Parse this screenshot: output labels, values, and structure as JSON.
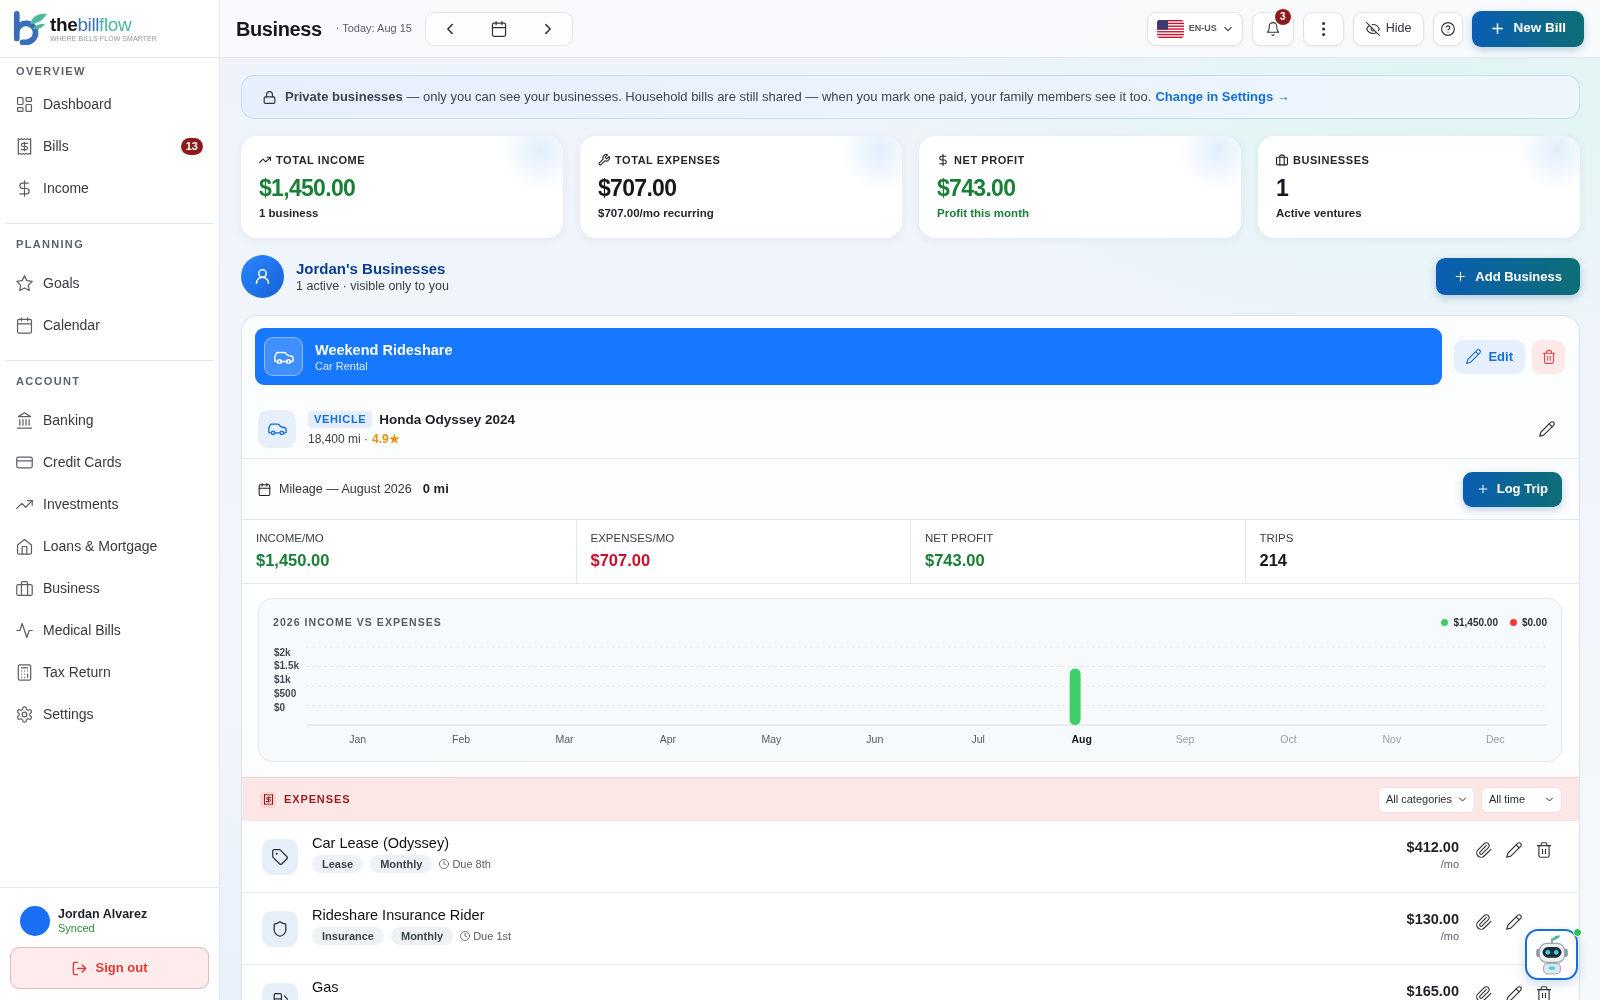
{
  "brand": {
    "wordmark": [
      {
        "text": "the",
        "color": "#161616",
        "bold": true
      },
      {
        "text": "bill",
        "color": "#3d72c0",
        "bold": false
      },
      {
        "text": "flow",
        "color": "#4cb89c",
        "bold": false
      }
    ],
    "tagline": "WHERE BILLS FLOW SMARTER"
  },
  "sidebar": {
    "sections": [
      {
        "label": "OVERVIEW",
        "items": [
          {
            "label": "Dashboard",
            "kind": "dashboard",
            "selected": false
          },
          {
            "label": "Bills",
            "kind": "bills",
            "selected": false,
            "badge": "13"
          },
          {
            "label": "Income",
            "kind": "income",
            "selected": false
          }
        ]
      },
      {
        "label": "PLANNING",
        "items": [
          {
            "label": "Goals",
            "kind": "goals",
            "selected": false
          },
          {
            "label": "Calendar",
            "kind": "calendar",
            "selected": false
          }
        ]
      },
      {
        "label": "ACCOUNT",
        "items": [
          {
            "label": "Banking",
            "kind": "banking",
            "selected": false
          },
          {
            "label": "Credit Cards",
            "kind": "cards",
            "selected": false
          },
          {
            "label": "Investments",
            "kind": "investments",
            "selected": false
          },
          {
            "label": "Loans & Mortgage",
            "kind": "loans",
            "selected": false
          },
          {
            "label": "Business",
            "kind": "business",
            "selected": false
          },
          {
            "label": "Medical Bills",
            "kind": "medical",
            "selected": false
          },
          {
            "label": "Tax Return",
            "kind": "tax",
            "selected": false
          },
          {
            "label": "Settings",
            "kind": "settings",
            "selected": false
          }
        ]
      }
    ],
    "user": {
      "name": "Jordan Alvarez",
      "status": "Synced"
    },
    "sign_out": "Sign out"
  },
  "header": {
    "title": "Business",
    "date": "· Today: Aug 15",
    "language": "EN-US",
    "notifications": "3",
    "hide": "Hide",
    "new_bill": "New Bill"
  },
  "notice": {
    "text": "**Private businesses** — only you can see your businesses. Household bills are still shared — when you mark one paid, your family members see it too.",
    "link": "Change in Settings →"
  },
  "summary": [
    {
      "kind": "income",
      "label": "TOTAL INCOME",
      "value": "$1,450.00",
      "note": "1 business"
    },
    {
      "kind": "expense",
      "label": "TOTAL EXPENSES",
      "value": "$707.00",
      "note": "$707.00/mo recurring"
    },
    {
      "kind": "profit",
      "label": "NET PROFIT",
      "value": "$743.00",
      "note": "Profit this month"
    },
    {
      "kind": "count",
      "label": "BUSINESSES",
      "value": "1",
      "note": "Active ventures"
    }
  ],
  "owner": {
    "title": "Jordan's Businesses",
    "subtitle": "1 active · visible only to you",
    "add_button": "Add Business"
  },
  "businesses": [
    {
      "name": "Weekend Rideshare",
      "type": "Car Rental",
      "selected": true,
      "edit": "Edit",
      "vehicle": {
        "tag": "VEHICLE",
        "name": "Honda Odyssey 2024",
        "odometer": "18,400 mi ·",
        "rating": "4.9★"
      },
      "mileage": {
        "label": "Mileage — August 2026",
        "value": "0 mi",
        "button": "Log Trip"
      },
      "stats": [
        {
          "kind": "income",
          "label": "INCOME/MO",
          "value": "$1,450.00"
        },
        {
          "kind": "expense",
          "label": "EXPENSES/MO",
          "value": "$707.00"
        },
        {
          "kind": "profit",
          "label": "NET PROFIT",
          "value": "$743.00"
        },
        {
          "kind": "count",
          "label": "TRIPS",
          "value": "214"
        }
      ],
      "chart": {
        "chart_data": {
          "type": "bar",
          "title": "2026 INCOME VS EXPENSES",
          "categories": [
            "Jan",
            "Feb",
            "Mar",
            "Apr",
            "May",
            "Jun",
            "Jul",
            "Aug",
            "Sep",
            "Oct",
            "Nov",
            "Dec"
          ],
          "series": [
            {
              "name": "$1,450.00",
              "color": "#3ecf6b",
              "values": [
                0,
                0,
                0,
                0,
                0,
                0,
                0,
                1450,
                null,
                null,
                null,
                null
              ]
            },
            {
              "name": "$0.00",
              "color": "#ef3b3b",
              "values": [
                0,
                0,
                0,
                0,
                0,
                0,
                0,
                0,
                null,
                null,
                null,
                null
              ]
            }
          ],
          "ylim": [
            0,
            2000
          ],
          "yticks": [
            {
              "value": 2000,
              "label": "$2k"
            },
            {
              "value": 1500,
              "label": "$1.5k"
            },
            {
              "value": 1000,
              "label": "$1k"
            },
            {
              "value": 500,
              "label": "$500"
            },
            {
              "value": 0,
              "label": "$0"
            }
          ]
        },
        "months": [
          {
            "selected": false,
            "disabled": false
          },
          {
            "selected": false,
            "disabled": false
          },
          {
            "selected": false,
            "disabled": false
          },
          {
            "selected": false,
            "disabled": false
          },
          {
            "selected": false,
            "disabled": false
          },
          {
            "selected": false,
            "disabled": false
          },
          {
            "selected": false,
            "disabled": false
          },
          {
            "selected": true,
            "disabled": false
          },
          {
            "selected": false,
            "disabled": true
          },
          {
            "selected": false,
            "disabled": true
          },
          {
            "selected": false,
            "disabled": true
          },
          {
            "selected": false,
            "disabled": true
          }
        ]
      },
      "expenses": {
        "title": "EXPENSES",
        "category_filter": "All categories",
        "time_filter": "All time",
        "items": [
          {
            "kind": "lease",
            "name": "Car Lease (Odyssey)",
            "tags": [
              "Lease",
              "Monthly"
            ],
            "due": "Due 8th",
            "amount": "$412.00",
            "period": "/mo",
            "actions": {
              "attach": true,
              "edit": true,
              "delete": true
            }
          },
          {
            "kind": "insurance",
            "name": "Rideshare Insurance Rider",
            "tags": [
              "Insurance",
              "Monthly"
            ],
            "due": "Due 1st",
            "amount": "$130.00",
            "period": "/mo",
            "actions": {
              "attach": true,
              "edit": true
            }
          },
          {
            "kind": "fuel",
            "name": "Gas",
            "amount": "$165.00",
            "actions": {
              "attach": true,
              "edit": true,
              "delete": true
            }
          }
        ]
      }
    }
  ],
  "assistant": {
    "online": true
  }
}
